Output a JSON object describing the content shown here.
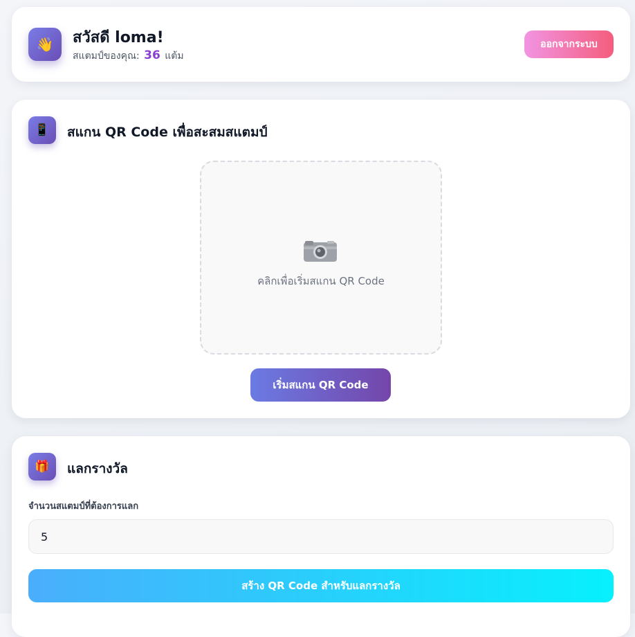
{
  "header": {
    "greeting": "สวัสดี loma!",
    "stamp_prefix": "สแตมป์ของคุณ:",
    "stamp_count": "36",
    "stamp_unit": "แต้ม",
    "logout_label": "ออกจากระบบ",
    "avatar_icon": "waving-hand-icon"
  },
  "scan": {
    "title": "สแกน QR Code เพื่อสะสมสแตมป์",
    "icon": "mobile-phone-icon",
    "hint": "คลิกเพื่อเริ่มสแกน QR Code",
    "camera_icon": "camera-icon",
    "button_label": "เริ่มสแกน QR Code"
  },
  "redeem": {
    "title": "แลกรางวัล",
    "icon": "gift-icon",
    "field_label": "จำนวนสแตมป์ที่ต้องการแลก",
    "field_value": "5",
    "button_label": "สร้าง QR Code สำหรับแลกรางวัล"
  },
  "colors": {
    "accent_purple": "#8b3fd1",
    "logout_gradient": [
      "#f294e2",
      "#f45d7d"
    ],
    "scan_gradient": [
      "#6b7be3",
      "#7446aa"
    ],
    "create_gradient": [
      "#4aaefc",
      "#07f0fd"
    ]
  }
}
